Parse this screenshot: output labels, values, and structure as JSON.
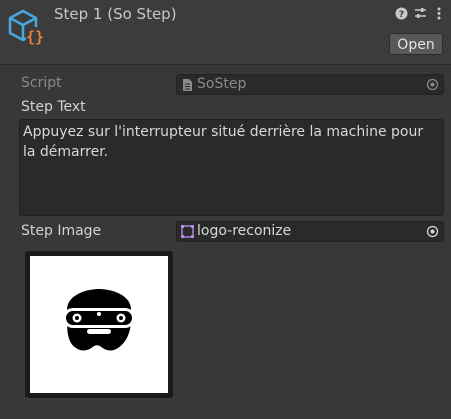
{
  "header": {
    "title": "Step 1 (So Step)",
    "help_icon": "help-icon",
    "settings_icon": "preset-sliders-icon",
    "menu_icon": "kebab-menu-icon",
    "open_label": "Open"
  },
  "fields": {
    "script": {
      "label": "Script",
      "value": "SoStep"
    },
    "step_text": {
      "label": "Step Text",
      "value": "Appuyez sur l'interrupteur situé derrière la machine pour la démarrer."
    },
    "step_image": {
      "label": "Step Image",
      "value": "logo-reconize"
    }
  },
  "colors": {
    "background": "#383838",
    "field": "#2a2a2a",
    "asset_icon_blue": "#4aa8e0",
    "asset_icon_orange": "#e8803a"
  }
}
